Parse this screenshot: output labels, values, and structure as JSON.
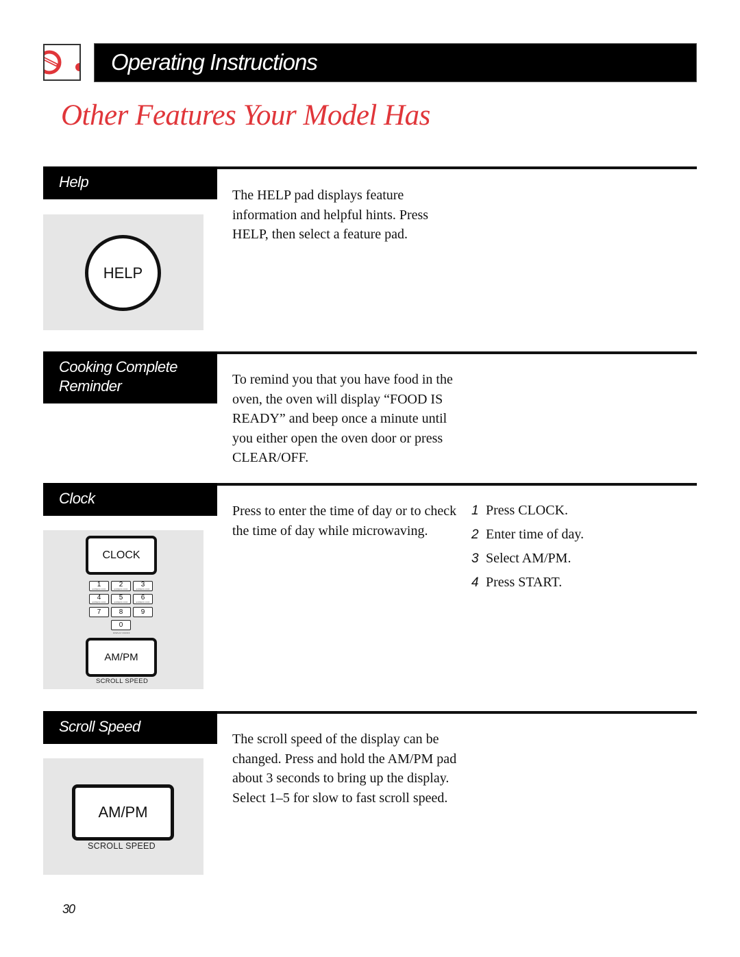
{
  "header": {
    "logo_icon": "range-dial-icon",
    "title": "Operating Instructions"
  },
  "page_title": "Other Features Your Model Has",
  "sections": {
    "help": {
      "label": "Help",
      "text": "The HELP pad displays feature information and helpful hints. Press HELP, then select a feature pad.",
      "pad_label": "HELP"
    },
    "cooking_complete": {
      "label_line1": "Cooking Complete",
      "label_line2": "Reminder",
      "text": "To remind you that you have food in the oven, the oven will display “FOOD IS READY” and beep once a minute until you either open the oven door or press CLEAR/OFF."
    },
    "clock": {
      "label": "Clock",
      "text": "Press to enter the time of day or to check the time of day while microwaving.",
      "clock_pad_label": "CLOCK",
      "ampm_pad_label": "AM/PM",
      "ampm_caption": "SCROLL SPEED",
      "keypad": [
        {
          "digit": "1",
          "sub": "EXPRESS COOK"
        },
        {
          "digit": "2",
          "sub": "EXPRESS COOK"
        },
        {
          "digit": "3",
          "sub": "EXPRESS COOK"
        },
        {
          "digit": "4",
          "sub": "EXPRESS COOK"
        },
        {
          "digit": "5",
          "sub": "EXPRESS COOK"
        },
        {
          "digit": "6",
          "sub": "EXPRESS COOK"
        },
        {
          "digit": "7",
          "sub": ""
        },
        {
          "digit": "8",
          "sub": ""
        },
        {
          "digit": "9",
          "sub": ""
        },
        {
          "digit": "0",
          "sub": ""
        }
      ],
      "zero_caption": "DISPLAY ON/OFF",
      "steps": [
        {
          "num": "1",
          "text": "Press CLOCK."
        },
        {
          "num": "2",
          "text": "Enter time of day."
        },
        {
          "num": "3",
          "text": "Select AM/PM."
        },
        {
          "num": "4",
          "text": "Press START."
        }
      ]
    },
    "scroll_speed": {
      "label": "Scroll Speed",
      "text": "The scroll speed of the display can be changed. Press and hold the AM/PM pad about 3 seconds to bring up the display. Select 1–5 for slow to fast scroll speed.",
      "pad_label": "AM/PM",
      "pad_caption": "SCROLL SPEED"
    }
  },
  "colors": {
    "accent_red": "#e0363a",
    "label_bg": "#000000",
    "illustration_bg": "#e6e6e6"
  },
  "page_number": "30"
}
